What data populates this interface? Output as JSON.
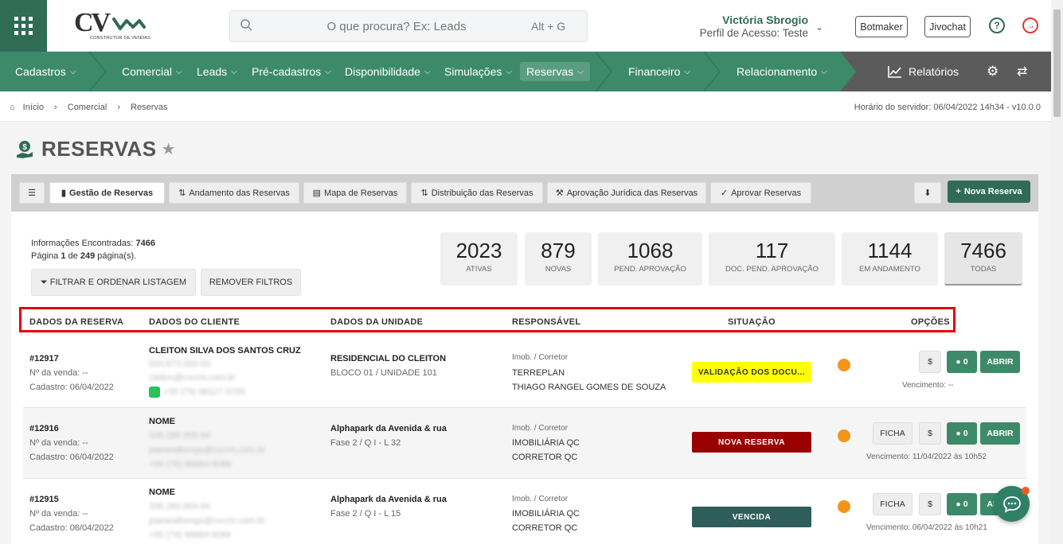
{
  "header": {
    "search_placeholder": "O que procura? Ex: Leads",
    "search_shortcut": "Alt + G",
    "logo_text": "CV",
    "logo_sub": "CONSTRUTOR DE VENDAS",
    "user_name": "Victória Sbrogio",
    "user_role": "Perfil de Acesso: Teste",
    "btn_botmaker": "Botmaker",
    "btn_jivochat": "Jivochat"
  },
  "nav": {
    "items": [
      "Cadastros",
      "Comercial",
      "Leads",
      "Pré-cadastros",
      "Disponibilidade",
      "Simulações",
      "Reservas",
      "Financeiro",
      "Relacionamento"
    ],
    "reports": "Relatórios",
    "colors": {
      "primary": "#3d8a6a",
      "dark": "#2f6b55",
      "grey": "#555555"
    }
  },
  "breadcrumb": {
    "items": [
      "Início",
      "Comercial",
      "Reservas"
    ],
    "server_time": "Horário do servidor: 06/04/2022 14h34 - v10.0.0"
  },
  "page": {
    "title": "RESERVAS"
  },
  "tabs": {
    "items": [
      "Gestão de Reservas",
      "Andamento das Reservas",
      "Mapa de Reservas",
      "Distribuição das Reservas",
      "Aprovação Jurídica das Reservas",
      "Aprovar Reservas"
    ],
    "new_button": "Nova Reserva"
  },
  "info": {
    "found_label": "Informações Encontradas:",
    "found_value": "7466",
    "page_text_prefix": "Página",
    "page_current": "1",
    "page_of": "de",
    "page_total": "249",
    "page_suffix": "página(s).",
    "filter_button": "FILTRAR E ORDENAR LISTAGEM",
    "clear_button": "REMOVER FILTROS"
  },
  "stats": [
    {
      "value": "2023",
      "label": "ATIVAS"
    },
    {
      "value": "879",
      "label": "NOVAS"
    },
    {
      "value": "1068",
      "label": "PEND. APROVAÇÃO"
    },
    {
      "value": "117",
      "label": "DOC. PEND. APROVAÇÃO"
    },
    {
      "value": "1144",
      "label": "EM ANDAMENTO"
    },
    {
      "value": "7466",
      "label": "TODAS"
    }
  ],
  "table": {
    "headers": [
      "DADOS DA RESERVA",
      "DADOS DO CLIENTE",
      "DADOS DA UNIDADE",
      "RESPONSÁVEL",
      "SITUAÇÃO",
      "OPÇÕES"
    ],
    "rows": [
      {
        "id": "#12917",
        "sale": "Nº da venda: --",
        "created": "Cadastro: 06/04/2022",
        "client": "CLEITON SILVA DOS SANTOS CRUZ",
        "client_blur": [
          "000.873.000-00",
          "cleiton@cvcrm.com.br",
          "+55 (79) 98127-9785"
        ],
        "unit": "RESIDENCIAL DO CLEITON",
        "unit_sub": "BLOCO 01 / UNIDADE 101",
        "resp_label": "Imob. / Corretor",
        "resp_1": "TERREPLAN",
        "resp_2": "THIAGO RANGEL GOMES DE SOUZA",
        "status": "VALIDAÇÃO DOS DOCU...",
        "status_bg": "#ffff00",
        "status_fg": "#333333",
        "chat_count": "0",
        "open": "ABRIR",
        "money": "$",
        "due": "Vencimento: --"
      },
      {
        "id": "#12916",
        "sale": "Nº da venda: --",
        "created": "Cadastro: 06/04/2022",
        "client": "NOME",
        "client_blur": [
          "336.289.959-94",
          "paesealbongo@cvcrm.com.br",
          "+55 (79) 99684-9089"
        ],
        "unit": "Alphapark da Avenida & rua",
        "unit_sub": "Fase 2 / Q I - L 32",
        "resp_label": "Imob. / Corretor",
        "resp_1": "IMOBILIÁRIA QC",
        "resp_2": "CORRETOR QC",
        "status": "NOVA RESERVA",
        "status_bg": "#9b0000",
        "status_fg": "#ffffff",
        "ficha": "FICHA",
        "chat_count": "0",
        "open": "ABRIR",
        "money": "$",
        "due": "Vencimento: 11/04/2022 às 10h52"
      },
      {
        "id": "#12915",
        "sale": "Nº da venda: --",
        "created": "Cadastro: 06/04/2022",
        "client": "NOME",
        "client_blur": [
          "336.289.959-94",
          "paesealbongo@cvcrm.com.br",
          "+55 (79) 99684-9089"
        ],
        "unit": "Alphapark da Avenida & rua",
        "unit_sub": "Fase 2 / Q I - L 15",
        "resp_label": "Imob. / Corretor",
        "resp_1": "IMOBILIÁRIA QC",
        "resp_2": "CORRETOR QC",
        "status": "VENCIDA",
        "status_bg": "#2e5d5a",
        "status_fg": "#ffffff",
        "ficha": "FICHA",
        "chat_count": "0",
        "open": "ABRIR",
        "money": "$",
        "due": "Vencimento: 06/04/2022 às 10h21"
      }
    ]
  }
}
